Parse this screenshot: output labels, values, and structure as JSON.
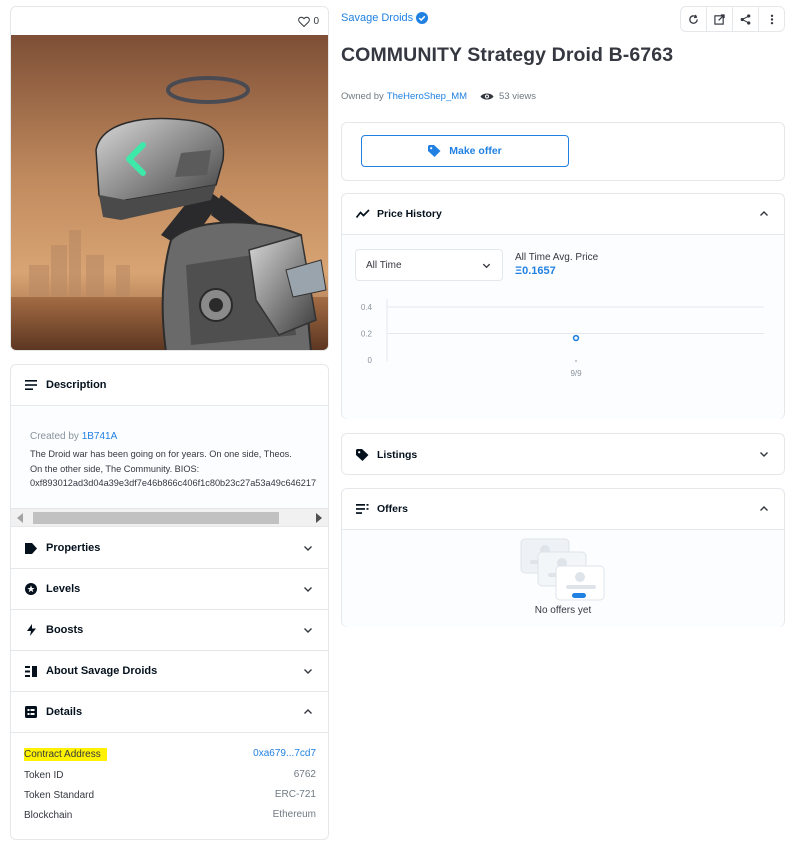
{
  "image_card": {
    "favorites_count": "0"
  },
  "collection": {
    "name": "Savage Droids"
  },
  "item": {
    "title": "COMMUNITY Strategy Droid B-6763",
    "owned_by_label": "Owned by",
    "owner": "TheHeroShep_MM",
    "views": "53 views"
  },
  "actions": {
    "make_offer_label": "Make offer"
  },
  "left_panel": {
    "description": {
      "label": "Description",
      "created_by_label": "Created by",
      "creator": "1B741A",
      "lines": [
        "The Droid war has been going on for years. On one side, Theos.",
        "On the other side, The Community. BIOS:",
        "0xf893012ad3d04a39e3df7e46b866c406f1c80b23c27a53a49c646217"
      ]
    },
    "sections": [
      "Properties",
      "Levels",
      "Boosts",
      "About Savage Droids",
      "Details"
    ],
    "details": [
      {
        "key": "Contract Address",
        "value": "0xa679...7cd7"
      },
      {
        "key": "Token ID",
        "value": "6762"
      },
      {
        "key": "Token Standard",
        "value": "ERC-721"
      },
      {
        "key": "Blockchain",
        "value": "Ethereum"
      }
    ]
  },
  "price_history": {
    "label": "Price History",
    "time_filter": "All Time",
    "avg_label": "All Time Avg. Price",
    "avg_value": "Ξ0.1657"
  },
  "chart_data": {
    "type": "scatter",
    "x": [
      "9/9"
    ],
    "y": [
      0.1657
    ],
    "ylim": [
      0,
      0.4
    ],
    "yticks": [
      "0.4",
      "0.2",
      "0"
    ],
    "grid": true
  },
  "listings": {
    "label": "Listings"
  },
  "offers": {
    "label": "Offers",
    "empty_text": "No offers yet"
  },
  "colors": {
    "accent": "#2081e2",
    "border": "#e5e8eb",
    "highlight": "#fff200"
  },
  "icons": [
    "heart-icon",
    "verified-badge-icon",
    "refresh-icon",
    "external-link-icon",
    "share-icon",
    "more-icon",
    "eye-icon",
    "tag-icon",
    "chart-line-icon",
    "chevron-up-icon",
    "chevron-down-icon",
    "description-icon",
    "star-icon",
    "bolt-icon",
    "about-icon",
    "details-icon",
    "offers-list-icon"
  ]
}
